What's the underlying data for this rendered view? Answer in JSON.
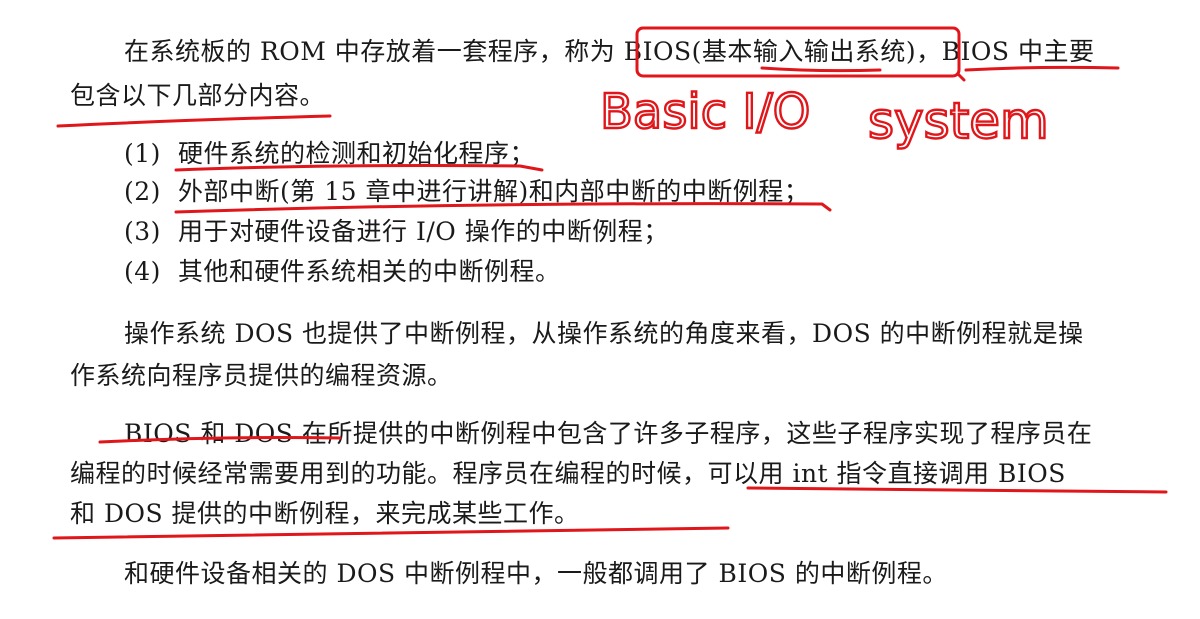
{
  "paragraphs": {
    "p1_line1": "在系统板的 ROM 中存放着一套程序，称为 BIOS(基本输入输出系统)，BIOS 中主要",
    "p1_line2": "包含以下几部分内容。",
    "items": [
      {
        "num": "(1)",
        "text": "硬件系统的检测和初始化程序；"
      },
      {
        "num": "(2)",
        "text": "外部中断(第 15 章中进行讲解)和内部中断的中断例程；"
      },
      {
        "num": "(3)",
        "text": "用于对硬件设备进行 I/O 操作的中断例程；"
      },
      {
        "num": "(4)",
        "text": "其他和硬件系统相关的中断例程。"
      }
    ],
    "p2_line1": "操作系统 DOS 也提供了中断例程，从操作系统的角度来看，DOS 的中断例程就是操",
    "p2_line2": "作系统向程序员提供的编程资源。",
    "p3_line1": "BIOS 和 DOS 在所提供的中断例程中包含了许多子程序，这些子程序实现了程序员在",
    "p3_line2": "编程的时候经常需要用到的功能。程序员在编程的时候，可以用 int 指令直接调用 BIOS",
    "p3_line3": "和 DOS 提供的中断例程，来完成某些工作。",
    "p4_line1": "和硬件设备相关的 DOS 中断例程中，一般都调用了 BIOS 的中断例程。"
  },
  "annotations": {
    "handwriting_1": "Basic I/O",
    "handwriting_2": "system"
  },
  "colors": {
    "text": "#1a1a1a",
    "annotation": "#e0161b",
    "background": "#ffffff"
  }
}
